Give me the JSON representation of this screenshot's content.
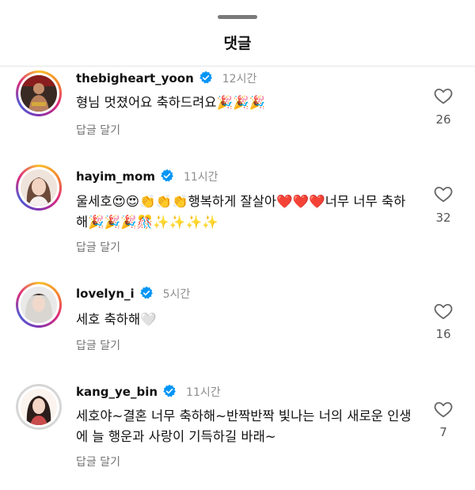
{
  "header": {
    "title": "댓글"
  },
  "reply_label": "답글 달기",
  "comments": [
    {
      "username": "thebigheart_yoon",
      "time": "12시간",
      "text": "형님 멋졌어요 축하드려요🎉🎉🎉",
      "likes": "26"
    },
    {
      "username": "hayim_mom",
      "time": "11시간",
      "text": "울세호😍😍👏👏👏행복하게 잘살아❤️❤️❤️너무 너무 축하해🎉🎉🎉🎊✨✨✨✨",
      "likes": "32"
    },
    {
      "username": "lovelyn_i",
      "time": "5시간",
      "text": "세호 축하해🤍",
      "likes": "16"
    },
    {
      "username": "kang_ye_bin",
      "time": "11시간",
      "text": "세호야~결혼 너무 축하해~반짝반짝 빛나는 너의 새로운 인생에 늘 행운과 사랑이 기득하길 바래~",
      "likes": "7"
    }
  ],
  "icons": {
    "verified": "verified-badge-icon",
    "like": "heart-outline-icon"
  },
  "colors": {
    "verified": "#0095f6",
    "ring": "#dd2a7b"
  }
}
